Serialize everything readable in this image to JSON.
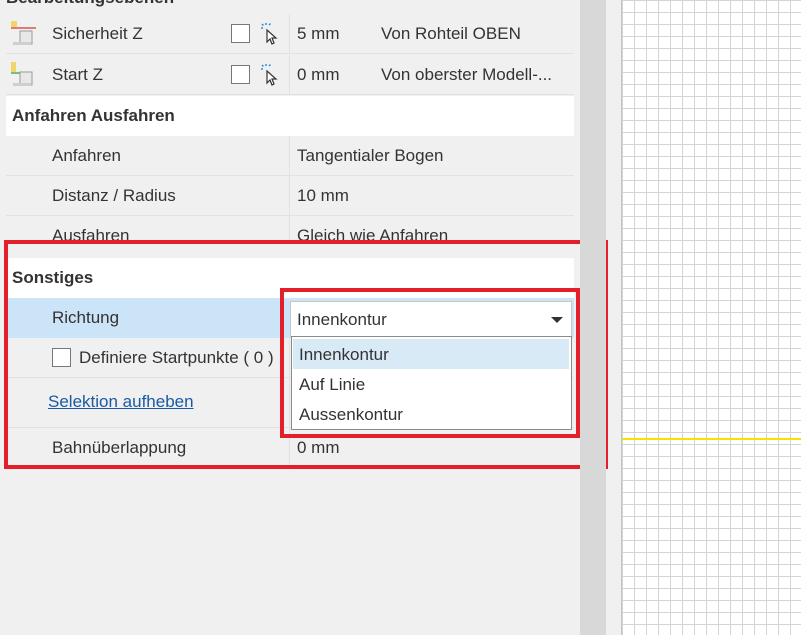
{
  "header": {
    "partial_title": "Bearbeitungsebenen"
  },
  "rows": {
    "sicherheit": {
      "label": "Sicherheit Z",
      "value": "5 mm",
      "reference": "Von Rohteil OBEN"
    },
    "start": {
      "label": "Start Z",
      "value": "0 mm",
      "reference": "Von oberster Modell-..."
    }
  },
  "sections": {
    "anfahren": "Anfahren Ausfahren",
    "sonstiges": "Sonstiges"
  },
  "anfahren": {
    "anfahren_label": "Anfahren",
    "anfahren_value": "Tangentialer Bogen",
    "distanz_label": "Distanz / Radius",
    "distanz_value": "10 mm",
    "ausfahren_label": "Ausfahren",
    "ausfahren_value": "Gleich wie Anfahren"
  },
  "sonstiges": {
    "richtung_label": "Richtung",
    "richtung_value": "Innenkontur",
    "startpunkte_label": "Definiere Startpunkte ( 0 )",
    "selektion_link": "Selektion aufheben",
    "bahn_label": "Bahnüberlappung",
    "bahn_value": "0 mm"
  },
  "dropdown": {
    "options": [
      "Innenkontur",
      "Auf Linie",
      "Aussenkontur"
    ],
    "selected": "Innenkontur"
  },
  "colors": {
    "highlight": "#e3202a",
    "selection": "#cce4f7",
    "link": "#1a5aa5",
    "grid_line": "#f2e500"
  },
  "icons": [
    "plane-icon",
    "pick-cursor-icon",
    "chevron-down-icon"
  ]
}
